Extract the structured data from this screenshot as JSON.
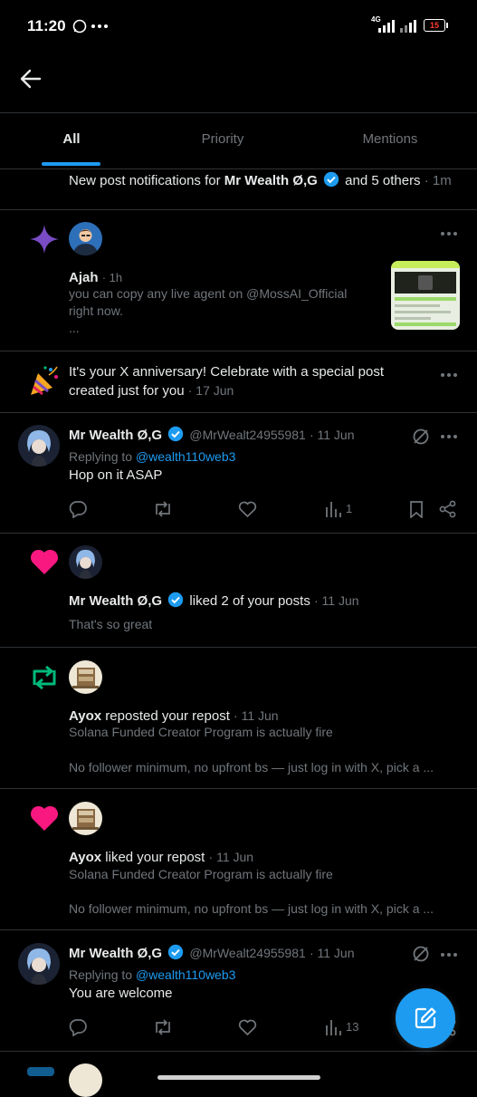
{
  "status_bar": {
    "time": "11:20",
    "network": "4G",
    "battery": "15"
  },
  "tabs": [
    {
      "label": "All",
      "active": true
    },
    {
      "label": "Priority",
      "active": false
    },
    {
      "label": "Mentions",
      "active": false
    }
  ],
  "notif_new_posts": {
    "prefix": "New post notifications for ",
    "name": "Mr Wealth Ø,G",
    "suffix": " and 5 others",
    "time": "· 1m"
  },
  "notif_ajah": {
    "name": "Ajah",
    "time": "· 1h",
    "line1": "you can copy any live agent on @MossAI_Official",
    "line2": "right now.",
    "line3": "..."
  },
  "notif_anniversary": {
    "line1": "It's your X anniversary! Celebrate with a special post",
    "line2": "created just for you",
    "time": "· 17 Jun"
  },
  "reply1": {
    "name": "Mr Wealth Ø,G",
    "handle": "@MrWealt24955981",
    "time": "· 11 Jun",
    "replying_prefix": "Replying to ",
    "replying_to": "@wealth110web3",
    "text": "Hop on it ASAP",
    "views": "1"
  },
  "like1": {
    "name": "Mr Wealth Ø,G",
    "action": " liked 2 of your posts",
    "time": "· 11 Jun",
    "text": "That's so great"
  },
  "repost1": {
    "name": "Ayox",
    "action": " reposted your repost",
    "time": "· 11 Jun",
    "line1": "Solana Funded Creator Program is actually fire",
    "line2": "No follower minimum, no upfront bs — just log in with X, pick a ..."
  },
  "like2": {
    "name": "Ayox",
    "action": " liked your repost",
    "time": "· 11 Jun",
    "line1": "Solana Funded Creator Program is actually fire",
    "line2": "No follower minimum, no upfront bs — just log in with X, pick a ..."
  },
  "reply2": {
    "name": "Mr Wealth Ø,G",
    "handle": "@MrWealt24955981",
    "time": "· 11 Jun",
    "replying_prefix": "Replying to ",
    "replying_to": "@wealth110web3",
    "text": "You are welcome",
    "views": "13"
  },
  "colors": {
    "accent": "#1d9bf0",
    "like": "#f91880",
    "repost": "#00ba7c",
    "star": "#794bc4"
  }
}
